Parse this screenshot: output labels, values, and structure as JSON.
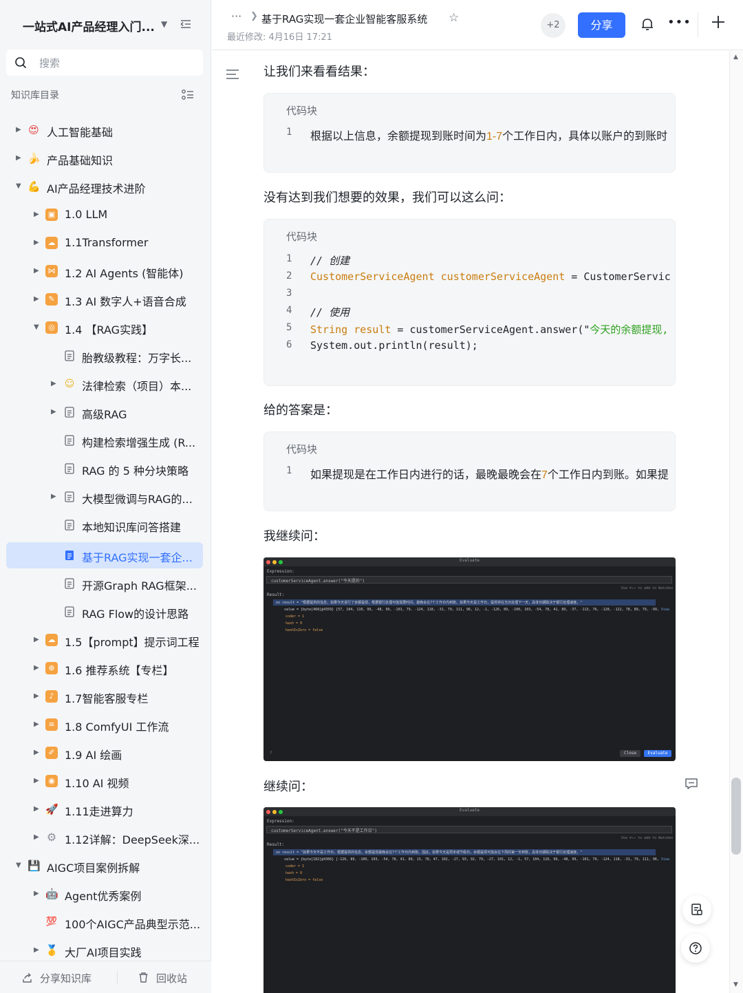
{
  "sidebar": {
    "title": "一站式AI产品经理入门...",
    "search_placeholder": "搜索",
    "section_title": "知识库目录",
    "items": [
      {
        "label": "人工智能基础",
        "icon": "heart-eyes-emoji-icon"
      },
      {
        "label": "产品基础知识",
        "icon": "banana-emoji-icon"
      },
      {
        "label": "AI产品经理技术进阶",
        "icon": "flexed-biceps-emoji-icon"
      },
      {
        "label": "1.0 LLM",
        "icon": "orange-folder-icon"
      },
      {
        "label": "1.1Transformer",
        "icon": "orange-cloud-icon"
      },
      {
        "label": "1.2 AI Agents (智能体)",
        "icon": "orange-share-icon"
      },
      {
        "label": "1.3 AI 数字人+语音合成",
        "icon": "orange-edit-icon"
      },
      {
        "label": "1.4 【RAG实践】",
        "icon": "orange-compass-icon"
      },
      {
        "label": "胎教级教程：万字长...",
        "icon": "document-icon"
      },
      {
        "label": "法律检索（项目）本...",
        "icon": "face-emoji-icon"
      },
      {
        "label": "高级RAG",
        "icon": "document-icon"
      },
      {
        "label": "构建检索增强生成 (R...",
        "icon": "document-icon"
      },
      {
        "label": "RAG 的 5 种分块策略",
        "icon": "document-icon"
      },
      {
        "label": "大模型微调与RAG的...",
        "icon": "document-icon"
      },
      {
        "label": "本地知识库问答搭建",
        "icon": "document-icon"
      },
      {
        "label": "基于RAG实现一套企...",
        "icon": "document-icon"
      },
      {
        "label": "开源Graph RAG框架...",
        "icon": "document-icon"
      },
      {
        "label": "RAG Flow的设计思路",
        "icon": "document-icon"
      },
      {
        "label": "1.5【prompt】提示词工程",
        "icon": "orange-cloud-icon"
      },
      {
        "label": "1.6 推荐系统【专栏】",
        "icon": "orange-globe-icon"
      },
      {
        "label": "1.7智能客服专栏",
        "icon": "orange-mic-icon"
      },
      {
        "label": "1.8 ComfyUI 工作流",
        "icon": "orange-doc-icon"
      },
      {
        "label": "1.9 AI 绘画",
        "icon": "orange-brush-icon"
      },
      {
        "label": "1.10 AI 视频",
        "icon": "orange-camera-icon"
      },
      {
        "label": "1.11走进算力",
        "icon": "rocket-emoji-icon"
      },
      {
        "label": "1.12详解：DeepSeek深...",
        "icon": "gear-emoji-icon"
      },
      {
        "label": "AIGC项目案例拆解",
        "icon": "floppy-disk-emoji-icon"
      },
      {
        "label": "Agent优秀案例",
        "icon": "robot-emoji-icon"
      },
      {
        "label": "100个AIGC产品典型示范...",
        "icon": "hundred-points-emoji-icon"
      },
      {
        "label": "大厂AI项目实践",
        "icon": "medal-emoji-icon"
      }
    ],
    "footer": {
      "share": "分享知识库",
      "recycle": "回收站"
    }
  },
  "topbar": {
    "more": "···",
    "doc_title": "基于RAG实现一套企业智能客服系统",
    "modified": "最近修改: 4月16日 17:21",
    "collaborators": "+2",
    "share_button": "分享"
  },
  "content": {
    "p1": "让我们来看看结果：",
    "code1": {
      "label": "代码块",
      "lines": [
        {
          "n": "1",
          "a": "根据以上信息，余额提现到账时间为",
          "b": "1-7",
          "c": "个工作日内，具体以账户的到账时"
        }
      ]
    },
    "p2": "没有达到我们想要的效果，我们可以这么问：",
    "code2": {
      "label": "代码块",
      "lines": [
        {
          "n": "1",
          "comment": "// 创建"
        },
        {
          "n": "2",
          "type": "CustomerServiceAgent customerServiceAgent",
          "rest": " = CustomerServic"
        },
        {
          "n": "3"
        },
        {
          "n": "4",
          "comment": "// 使用"
        },
        {
          "n": "5",
          "type": "String result",
          "rest": " = customerServiceAgent.answer(\"",
          "str": "今天的余额提现,"
        },
        {
          "n": "6",
          "plain": "System.out.println(result);"
        }
      ]
    },
    "p3": "给的答案是：",
    "code3": {
      "label": "代码块",
      "lines": [
        {
          "n": "1",
          "a": "如果提现是在工作日内进行的话，最晚最晚会在",
          "b": "7",
          "c": "个工作日内到账。如果提"
        }
      ]
    },
    "p4": "我继续问：",
    "ide1": {
      "title": "Evaluate",
      "expression_label": "Expression:",
      "expression": "customerServiceAgent.answer(\"今天提的\")",
      "hint": "Use ⌘⇧↩ to add to Watches",
      "result_label": "Result:",
      "result_line": "oo result = \"根据提供的信息，如果今天进行了余额提现，根据银行处理可能需要时间，最晚会在7个工作日内到账。如果今天是工作日，提现将在当日处理下一天，具体日期取决于银行处理速度。\"",
      "value_line": "value = {byte[468]@4359} [57, 104, 110, 99, -48, 99, -101, 79, -124, 118, -31, 79, 111, 96, 12, -1, -126, 89, -100, 103, -54, 78, 41, 89, -37, -113, 76, -120, -122, 78, 89, 79, -99, -104, -48, 9...",
      "view": "View",
      "coder": "coder = 1",
      "hash": "hash = 0",
      "hashzero": "hashIsZero = false",
      "help": "?",
      "close": "Close",
      "evaluate": "Evaluate"
    },
    "p5": "继续问：",
    "ide2": {
      "title": "Evaluate",
      "expression_label": "Expression:",
      "expression": "customerServiceAgent.answer(\"今天不是工作日\")",
      "hint": "Use ⌘⇧↩ to add to Watches",
      "result_label": "Result:",
      "result_line": "oo result = \"如果今天不是工作日，根据提供的信息，余额提现最晚会在7个工作日内到账。因此，如果今天是周末或节假日，余额提现可能会在下周的第一天到账，具体日期取决于银行处理速度。\"",
      "value_line": "value = {byte[182]@4366} [-126, 89, -100, 103, -54, 78, 41, 89, 13, 78, 47, 102, -27, 93, 92, 79, -27, 101, 12, -1, 57, 104, 110, 99, -48, 99, -101, 79, -124, 118, -31, 79, 111, 96, 12, -1, 89, 71...",
      "view": "View",
      "coder": "coder = 1",
      "hash": "hash = 0",
      "hashzero": "hashIsZero = false"
    }
  },
  "colors": {
    "accent": "#3370ff",
    "active_bg": "#d6e4fd",
    "orange": "#f5a241",
    "code_type": "#c97d10",
    "code_string": "#2ea121"
  }
}
